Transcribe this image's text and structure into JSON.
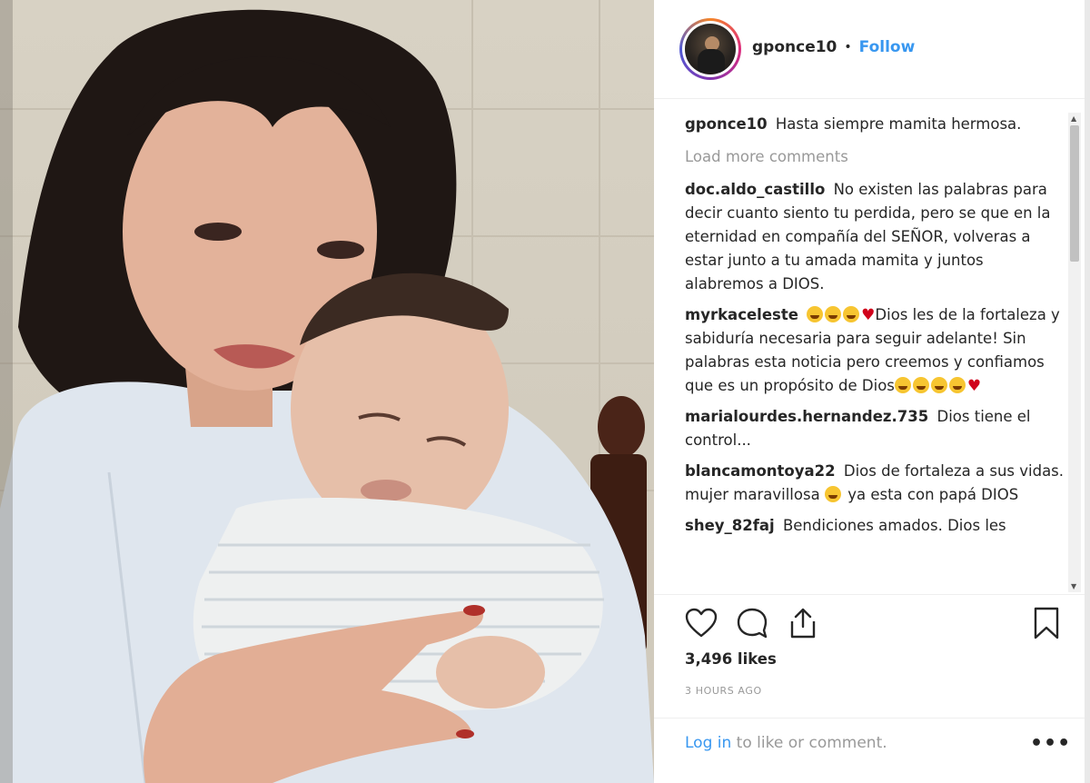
{
  "post": {
    "photo_alt": "",
    "header": {
      "username": "gponce10",
      "separator": "•",
      "follow_label": "Follow"
    },
    "caption": {
      "user": "gponce10",
      "text": "Hasta siempre mamita hermosa."
    },
    "load_more": "Load more comments",
    "comments": [
      {
        "user": "doc.aldo_castillo",
        "text": "No existen las palabras para decir cuanto siento tu perdida, pero se que en la eternidad en compañía del SEÑOR, volveras a estar junto a tu amada mamita y juntos alabremos a DIOS."
      },
      {
        "user": "myrkaceleste",
        "text_a": "Dios les de la fortaleza y sabiduría necesaria para seguir adelante! Sin palabras esta noticia pero creemos y confiamos que es un propósito de Dios"
      },
      {
        "user": "marialourdes.hernandez.735",
        "text": "Dios tiene el control..."
      },
      {
        "user": "blancamontoya22",
        "text_a": "Dios de fortaleza a sus vidas. mujer maravillosa",
        "text_b": "ya esta con papá DIOS"
      },
      {
        "user": "shey_82faj",
        "text": "Bendiciones amados. Dios les"
      }
    ],
    "likes": "3,496 likes",
    "timestamp": "3 HOURS AGO",
    "login_link": "Log in",
    "login_rest": " to like or comment.",
    "more_label": "•••"
  },
  "icons": [
    "heart-icon",
    "comment-icon",
    "share-icon",
    "bookmark-icon",
    "more-options-icon"
  ],
  "colors": {
    "link": "#3897f0",
    "muted": "#999999",
    "text": "#262626",
    "heart": "#d0021b"
  }
}
